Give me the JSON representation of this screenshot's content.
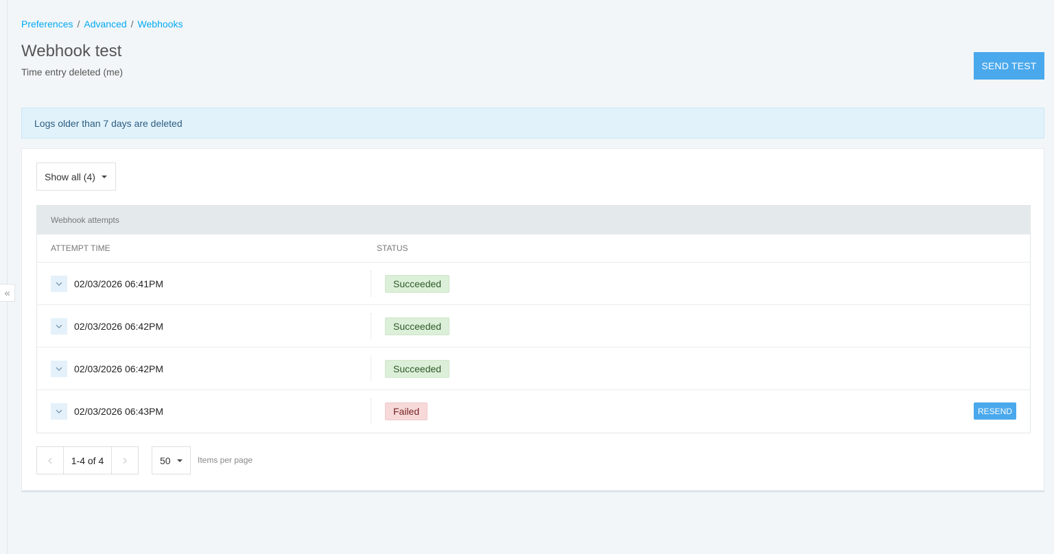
{
  "breadcrumb": {
    "items": [
      "Preferences",
      "Advanced",
      "Webhooks"
    ],
    "separator": "/"
  },
  "header": {
    "title": "Webhook test",
    "subtitle": "Time entry deleted (me)",
    "send_test_label": "SEND TEST"
  },
  "banner": {
    "text": "Logs older than 7 days are deleted"
  },
  "filter": {
    "selected": "Show all (4)"
  },
  "table": {
    "caption": "Webhook attempts",
    "columns": [
      "ATTEMPT TIME",
      "STATUS"
    ],
    "rows": [
      {
        "time": "02/03/2026 06:41PM",
        "status": "Succeeded"
      },
      {
        "time": "02/03/2026 06:42PM",
        "status": "Succeeded"
      },
      {
        "time": "02/03/2026 06:42PM",
        "status": "Succeeded"
      },
      {
        "time": "02/03/2026 06:43PM",
        "status": "Failed",
        "action": "RESEND"
      }
    ]
  },
  "pagination": {
    "range": "1-4 of 4",
    "prev_icon": "chevron-left-icon",
    "next_icon": "chevron-right-icon",
    "per_page": "50",
    "per_page_label": "Items per page"
  },
  "colors": {
    "accent": "#4aa8ec",
    "link": "#03a9f4",
    "success_bg": "#dcefd8",
    "fail_bg": "#f7d9d9"
  }
}
